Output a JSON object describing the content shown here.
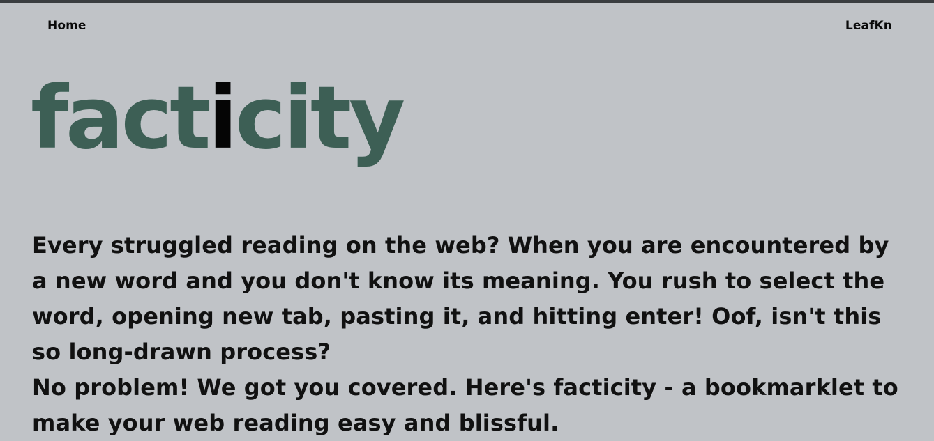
{
  "nav": {
    "home_label": "Home",
    "brand_label": "LeafKn"
  },
  "logo": {
    "part1": "fact",
    "highlight": "i",
    "part2": "city"
  },
  "intro": {
    "paragraph1": "Every struggled reading on the web? When you are encountered by a new word and you don't know its meaning. You rush to select the word, opening new tab, pasting it, and hitting enter! Oof, isn't this so long-drawn process?",
    "paragraph2": "No problem! We got you covered. Here's facticity - a bookmarklet to make your web reading easy and blissful."
  },
  "colors": {
    "background": "#c0c3c7",
    "top_bar": "#3a3d40",
    "logo_green": "#3d5f55",
    "logo_highlight": "#050505",
    "text": "#111111"
  }
}
